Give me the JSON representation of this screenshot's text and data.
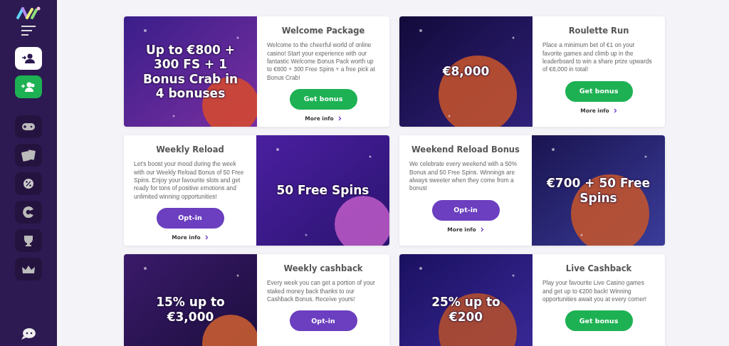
{
  "sidebar": {
    "nav_icons": [
      {
        "kind": "gamepad"
      },
      {
        "kind": "cards"
      },
      {
        "kind": "percent-badge"
      },
      {
        "kind": "crescent"
      },
      {
        "kind": "trophy"
      },
      {
        "kind": "crown"
      }
    ]
  },
  "promos": [
    {
      "title": "Welcome Package",
      "description": "Welcome to the cheerful world of online casino! Start your experience with our fantastic Welcome Bonus Pack worth up to €800 + 300 Free Spins + a free pick at Bonus Crab!",
      "image_text": "Up to €800 + 300 FS + 1 Bonus Crab in 4 bonuses",
      "kind": "image-left",
      "button": {
        "label": "Get bonus",
        "kind": "bonus"
      },
      "more_info": "More info"
    },
    {
      "title": "Roulette Run",
      "description": "Place a minimum bet of €1 on your favorite games and climb up in the leaderboard to win a share prize upwards of €8,000 in total!",
      "image_text": "€8,000",
      "kind": "image-left",
      "button": {
        "label": "Get bonus",
        "kind": "bonus"
      },
      "more_info": "More info"
    },
    {
      "title": "Weekly Reload",
      "description": "Let’s boost your mood during the week with our Weekly Reload Bonus of 50 Free Spins. Enjoy your favourite slots and get ready for tons of positive emotions and unlimited winning opportunities!",
      "image_text": "50 Free Spins",
      "kind": "image-right",
      "button": {
        "label": "Opt-in",
        "kind": "optin"
      },
      "more_info": "More info"
    },
    {
      "title": "Weekend Reload Bonus",
      "description": "We celebrate every weekend with a 50% Bonus and 50 Free Spins. Winnings are always sweeter when they come from a bonus!",
      "image_text": "€700 + 50 Free Spins",
      "kind": "image-right",
      "button": {
        "label": "Opt-in",
        "kind": "optin"
      },
      "more_info": "More info"
    },
    {
      "title": "Weekly cashback",
      "description": "Every week you can get a portion of your staked money back thanks to our Cashback Bonus. Receive yours!",
      "image_text": "15% up to €3,000",
      "kind": "image-left",
      "button": {
        "label": "Opt-in",
        "kind": "optin"
      }
    },
    {
      "title": "Live Cashback",
      "description": "Play your favourite Live Casino games and get up to €200 back! Winning opportunities await you at every corner!",
      "image_text": "25% up to €200",
      "kind": "image-left",
      "button": {
        "label": "Get bonus",
        "kind": "bonus"
      }
    }
  ]
}
